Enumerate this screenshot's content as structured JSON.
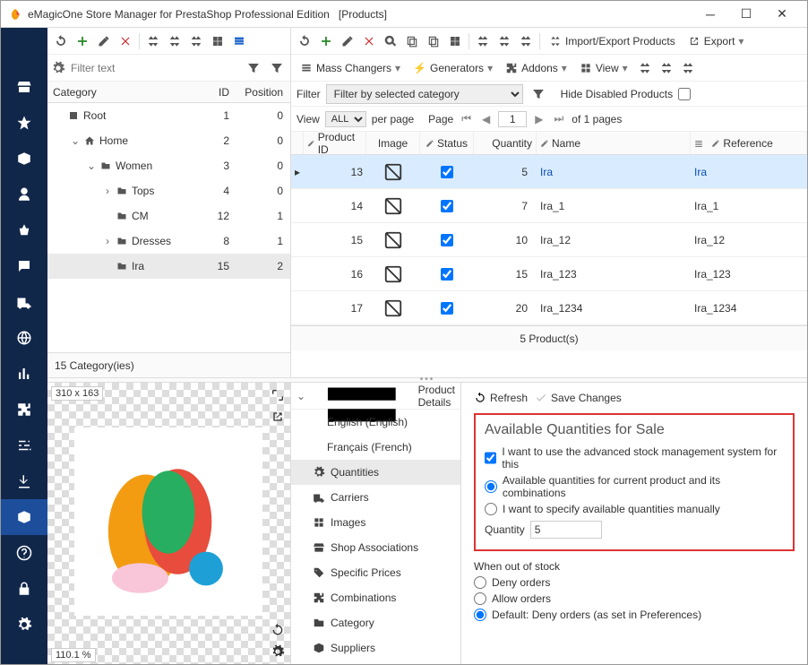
{
  "window": {
    "title": "eMagicOne Store Manager for PrestaShop Professional Edition",
    "context": "[Products]"
  },
  "leftToolbar": {
    "filter_placeholder": "Filter text"
  },
  "categoriesHeader": {
    "col1": "Category",
    "col2": "ID",
    "col3": "Position"
  },
  "tree": [
    {
      "indent": 0,
      "chev": "",
      "icon": "root",
      "name": "Root",
      "id": "1",
      "pos": "0"
    },
    {
      "indent": 1,
      "chev": "⌄",
      "icon": "home",
      "name": "Home",
      "id": "2",
      "pos": "0"
    },
    {
      "indent": 2,
      "chev": "⌄",
      "icon": "folder",
      "name": "Women",
      "id": "3",
      "pos": "0"
    },
    {
      "indent": 3,
      "chev": "›",
      "icon": "folder",
      "name": "Tops",
      "id": "4",
      "pos": "0"
    },
    {
      "indent": 3,
      "chev": "",
      "icon": "folder",
      "name": "CM",
      "id": "12",
      "pos": "1"
    },
    {
      "indent": 3,
      "chev": "›",
      "icon": "folder",
      "name": "Dresses",
      "id": "8",
      "pos": "1"
    },
    {
      "indent": 3,
      "chev": "",
      "icon": "folder",
      "name": "Ira",
      "id": "15",
      "pos": "2",
      "sel": true
    }
  ],
  "categoriesFooter": "15 Category(ies)",
  "massChangers": "Mass Changers",
  "generators": "Generators",
  "addons": "Addons",
  "viewBtn": "View",
  "importExport": "Import/Export Products",
  "exportBtn": "Export",
  "filterLabel": "Filter",
  "filterCombo": "Filter by selected category",
  "hideDisabled": "Hide Disabled Products",
  "viewLabel": "View",
  "viewAll": "ALL",
  "perPage": "per page",
  "pageLabel": "Page",
  "pageNum": "1",
  "ofPages": "of 1 pages",
  "gridHead": {
    "id": "Product ID",
    "img": "Image",
    "st": "Status",
    "qty": "Quantity",
    "nm": "Name",
    "ref": "Reference"
  },
  "rows": [
    {
      "id": "13",
      "qty": "5",
      "name": "Ira",
      "ref": "Ira",
      "sel": true
    },
    {
      "id": "14",
      "qty": "7",
      "name": "Ira_1",
      "ref": "Ira_1"
    },
    {
      "id": "15",
      "qty": "10",
      "name": "Ira_12",
      "ref": "Ira_12"
    },
    {
      "id": "16",
      "qty": "15",
      "name": "Ira_123",
      "ref": "Ira_123"
    },
    {
      "id": "17",
      "qty": "20",
      "name": "Ira_1234",
      "ref": "Ira_1234"
    }
  ],
  "productsFooter": "5 Product(s)",
  "image": {
    "dim": "310 x 163",
    "zoom": "110.1 %"
  },
  "detailNav": {
    "head": "Product Details",
    "items": [
      {
        "label": "English (English)",
        "sub": true
      },
      {
        "label": "Français (French)",
        "sub": true
      },
      {
        "label": "Quantities",
        "icon": "qty",
        "sel": true
      },
      {
        "label": "Carriers",
        "icon": "truck"
      },
      {
        "label": "Images",
        "icon": "img"
      },
      {
        "label": "Shop Associations",
        "icon": "shop"
      },
      {
        "label": "Specific Prices",
        "icon": "price"
      },
      {
        "label": "Combinations",
        "icon": "combo"
      },
      {
        "label": "Category",
        "icon": "cat"
      },
      {
        "label": "Suppliers",
        "icon": "sup"
      }
    ]
  },
  "form": {
    "refresh": "Refresh",
    "save": "Save Changes",
    "sectionTitle": "Available Quantities for Sale",
    "cb1": "I want to use the advanced stock management system for this",
    "rb1": "Available quantities for current product and its combinations",
    "rb2": "I want to specify available quantities manually",
    "qtyLabel": "Quantity",
    "qtyVal": "5",
    "oosHead": "When out of stock",
    "oos1": "Deny orders",
    "oos2": "Allow orders",
    "oos3": "Default: Deny orders (as set in Preferences)"
  }
}
